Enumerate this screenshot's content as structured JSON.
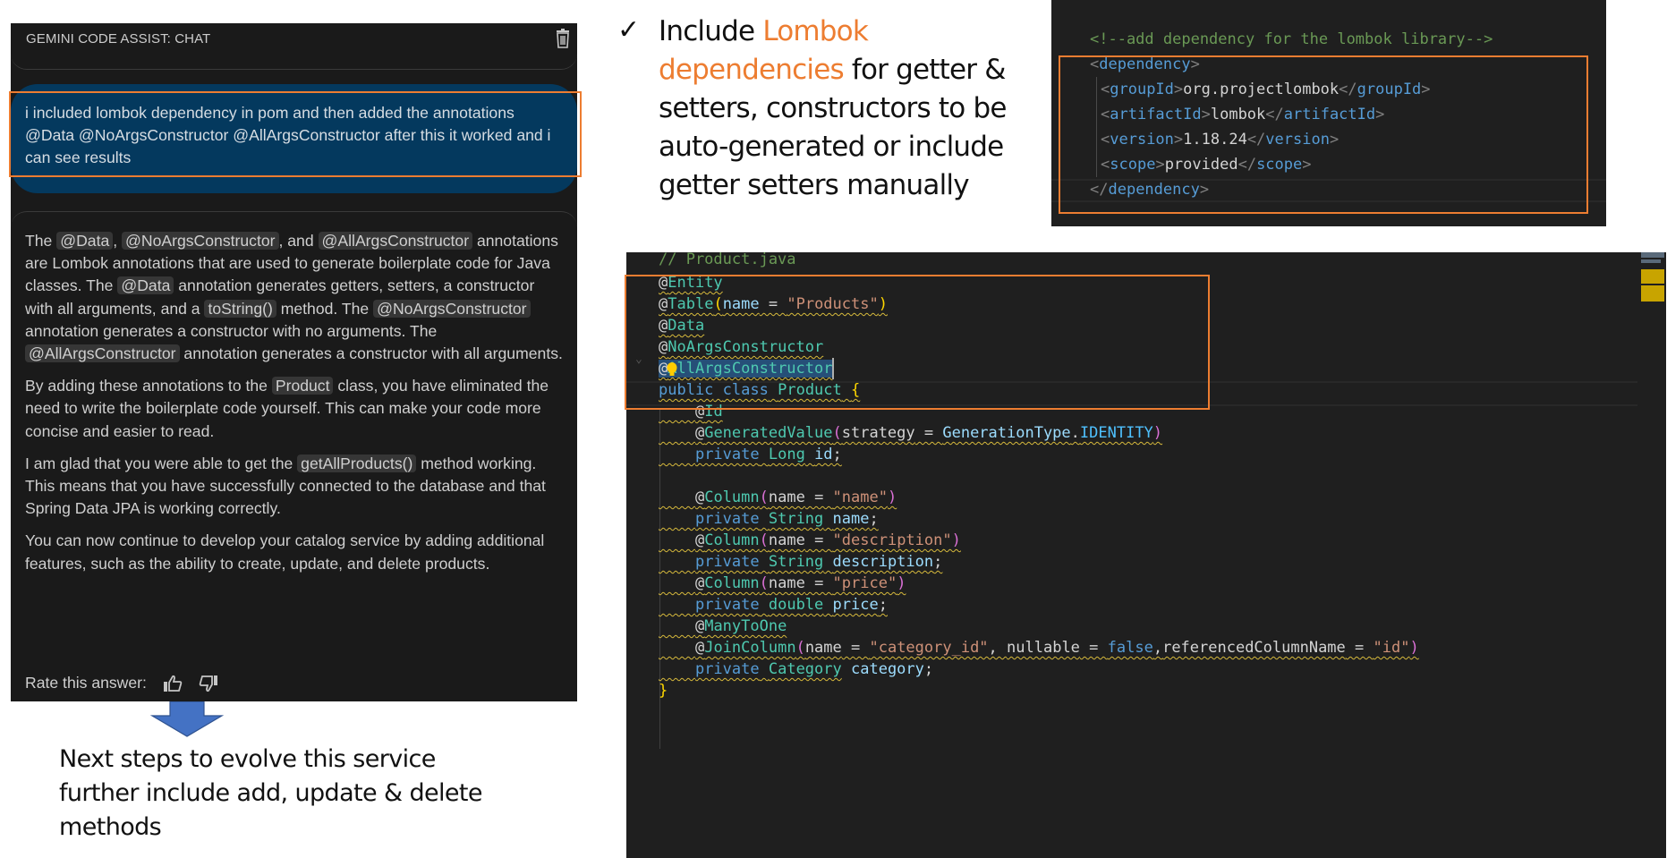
{
  "chat": {
    "title": "GEMINI CODE ASSIST: CHAT",
    "clear_icon": "trash-icon",
    "user_message": "i included lombok dependency in pom and then added the annotations @Data @NoArgsConstructor @AllArgsConstructor after this it worked and i can see results",
    "answer": {
      "p1": {
        "t1": "The ",
        "c1": "@Data",
        "t2": ", ",
        "c2": "@NoArgsConstructor",
        "t3": ", and ",
        "c3": "@AllArgsConstructor",
        "t4": " annotations are Lombok annotations that are used to generate boilerplate code for Java classes. The ",
        "c4": "@Data",
        "t5": " annotation generates getters, setters, a constructor with all arguments, and a ",
        "c5": "toString()",
        "t6": " method. The ",
        "c6": "@NoArgsConstructor",
        "t7": " annotation generates a constructor with no arguments. The ",
        "c7": "@AllArgsConstructor",
        "t8": " annotation generates a constructor with all arguments."
      },
      "p2": {
        "t1": "By adding these annotations to the ",
        "c1": "Product",
        "t2": " class, you have eliminated the need to write the boilerplate code yourself. This can make your code more concise and easier to read."
      },
      "p3": {
        "t1": "I am glad that you were able to get the ",
        "c1": "getAllProducts()",
        "t2": " method working. This means that you have successfully connected to the database and that Spring Data JPA is working correctly."
      },
      "p4": "You can now continue to develop your catalog service by adding additional features, such as the ability to create, update, and delete products."
    },
    "rate_label": "Rate this answer:",
    "thumbs_up_icon": "thumbs-up-icon",
    "thumbs_down_icon": "thumbs-down-icon"
  },
  "next_steps": "Next steps to  evolve this service further include add, update & delete methods",
  "bullet": {
    "check": "✓",
    "text_before": "Include ",
    "highlight": "Lombok dependencies",
    "text_after": " for getter & setters, constructors to be auto-generated or include getter setters manually"
  },
  "accent_color": "#ed7d31",
  "xml": {
    "comment": "<!--add dependency for the lombok library-->",
    "dependency_tag": "dependency",
    "entries": [
      {
        "tag": "groupId",
        "value": "org.projectlombok"
      },
      {
        "tag": "artifactId",
        "value": "lombok"
      },
      {
        "tag": "version",
        "value": "1.18.24"
      },
      {
        "tag": "scope",
        "value": "provided"
      }
    ]
  },
  "java": {
    "comment": "// Product.java",
    "annotations": {
      "entity": "Entity",
      "table": "Table",
      "table_arg": "name",
      "table_value": "\"Products\"",
      "data": "Data",
      "no_args": "NoArgsConstructor",
      "all_args": "AllArgsConstructor"
    },
    "class_decl": {
      "kw1": "public",
      "kw2": "class",
      "name": "Product"
    },
    "id": "Id",
    "generated": {
      "ann": "GeneratedValue",
      "arg": "strategy",
      "type": "GenerationType",
      "const": "IDENTITY"
    },
    "fields": [
      {
        "type": "Long",
        "name": "id"
      },
      {
        "type": "String",
        "name": "name"
      },
      {
        "type": "String",
        "name": "description"
      },
      {
        "type": "double",
        "name": "price"
      },
      {
        "type": "Category",
        "name": "category"
      }
    ],
    "columns": [
      "\"name\"",
      "\"description\"",
      "\"price\""
    ],
    "column_ann": "Column",
    "many_to_one": "ManyToOne",
    "join_column": {
      "ann": "JoinColumn",
      "name_value": "\"category_id\"",
      "nullable_key": "nullable",
      "nullable_value": "false",
      "ref_key": "referencedColumnName",
      "ref_value": "\"id\""
    },
    "private_kw": "private",
    "name_key": "name"
  }
}
